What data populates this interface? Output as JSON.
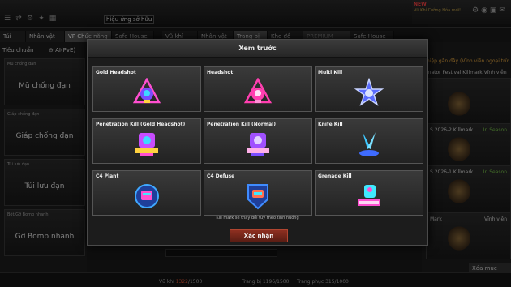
{
  "top": {
    "ownership_label": "hiệu ứng sở hữu",
    "new_badge": "NEW",
    "promo_text": "Vũ Khí Cường Hóa mới!"
  },
  "tabs_left": [
    {
      "label": "Túi"
    },
    {
      "label": "Nhân vật"
    },
    {
      "label": "VP Chức năng"
    },
    {
      "label": "Safe House"
    }
  ],
  "tabs_right": [
    {
      "label": "Vũ khí"
    },
    {
      "label": "Nhân vật"
    },
    {
      "label": "Trang bị"
    },
    {
      "label": "Kho đồ"
    },
    {
      "label": "PREMIUM"
    },
    {
      "label": "Safe House"
    }
  ],
  "filter": {
    "left_label": "Tiêu chuẩn",
    "ai_label": "AI(PvE)"
  },
  "left_cards": [
    {
      "head": "Mũ chống đạn",
      "name": "Mũ chống đạn"
    },
    {
      "head": "Giáp chống đạn",
      "name": "Giáp chống đạn"
    },
    {
      "head": "Túi lưu đạn",
      "name": "Túi lưu đạn"
    },
    {
      "head": "Bột/Gỡ Bomb nhanh",
      "name": "Gỡ Bomb nhanh"
    }
  ],
  "right_panel": {
    "header": "hiệp gần đây (Vĩnh viễn ngoại trừ",
    "sub": "inator Festival Killmark",
    "sub2": "Vĩnh viễn",
    "cards": [
      {
        "name": "S 2026-2 Killmark",
        "status": "In Season"
      },
      {
        "name": "S 2026-1 Killmark",
        "status": "In Season"
      },
      {
        "name": "Mark",
        "status": "Vĩnh viễn"
      }
    ]
  },
  "modal": {
    "title": "Xem trước",
    "note": "Kill mark sẽ thay đổi tùy theo tình huống",
    "confirm": "Xác nhận",
    "items": [
      {
        "label": "Gold Headshot",
        "icon": "gold-headshot-emblem-icon",
        "color": "#b04cff"
      },
      {
        "label": "Headshot",
        "icon": "headshot-emblem-icon",
        "color": "#ff3fb0"
      },
      {
        "label": "Multi Kill",
        "icon": "multi-kill-star-icon",
        "color": "#8fa8ff"
      },
      {
        "label": "Penetration Kill (Gold Headshot)",
        "icon": "penetration-gold-icon",
        "color": "#c84cff"
      },
      {
        "label": "Penetration Kill (Normal)",
        "icon": "penetration-normal-icon",
        "color": "#a050ff"
      },
      {
        "label": "Knife Kill",
        "icon": "knife-kill-icon",
        "color": "#3fc8ff"
      },
      {
        "label": "C4 Plant",
        "icon": "c4-plant-icon",
        "color": "#3fa8ff"
      },
      {
        "label": "C4 Defuse",
        "icon": "c4-defuse-icon",
        "color": "#3f8cff"
      },
      {
        "label": "Grenade Kill",
        "icon": "grenade-kill-popcorn-icon",
        "color": "#ff4fd0"
      }
    ]
  },
  "bottom": {
    "weapon_label": "Vũ khí",
    "weapon_count": "1322",
    "weapon_max": "/1500",
    "gear_label": "Trang bị",
    "gear_count": "1196/1500",
    "outfit_label": "Trang phục",
    "outfit_count": "315/1000",
    "delete_label": "Xóa mục"
  }
}
